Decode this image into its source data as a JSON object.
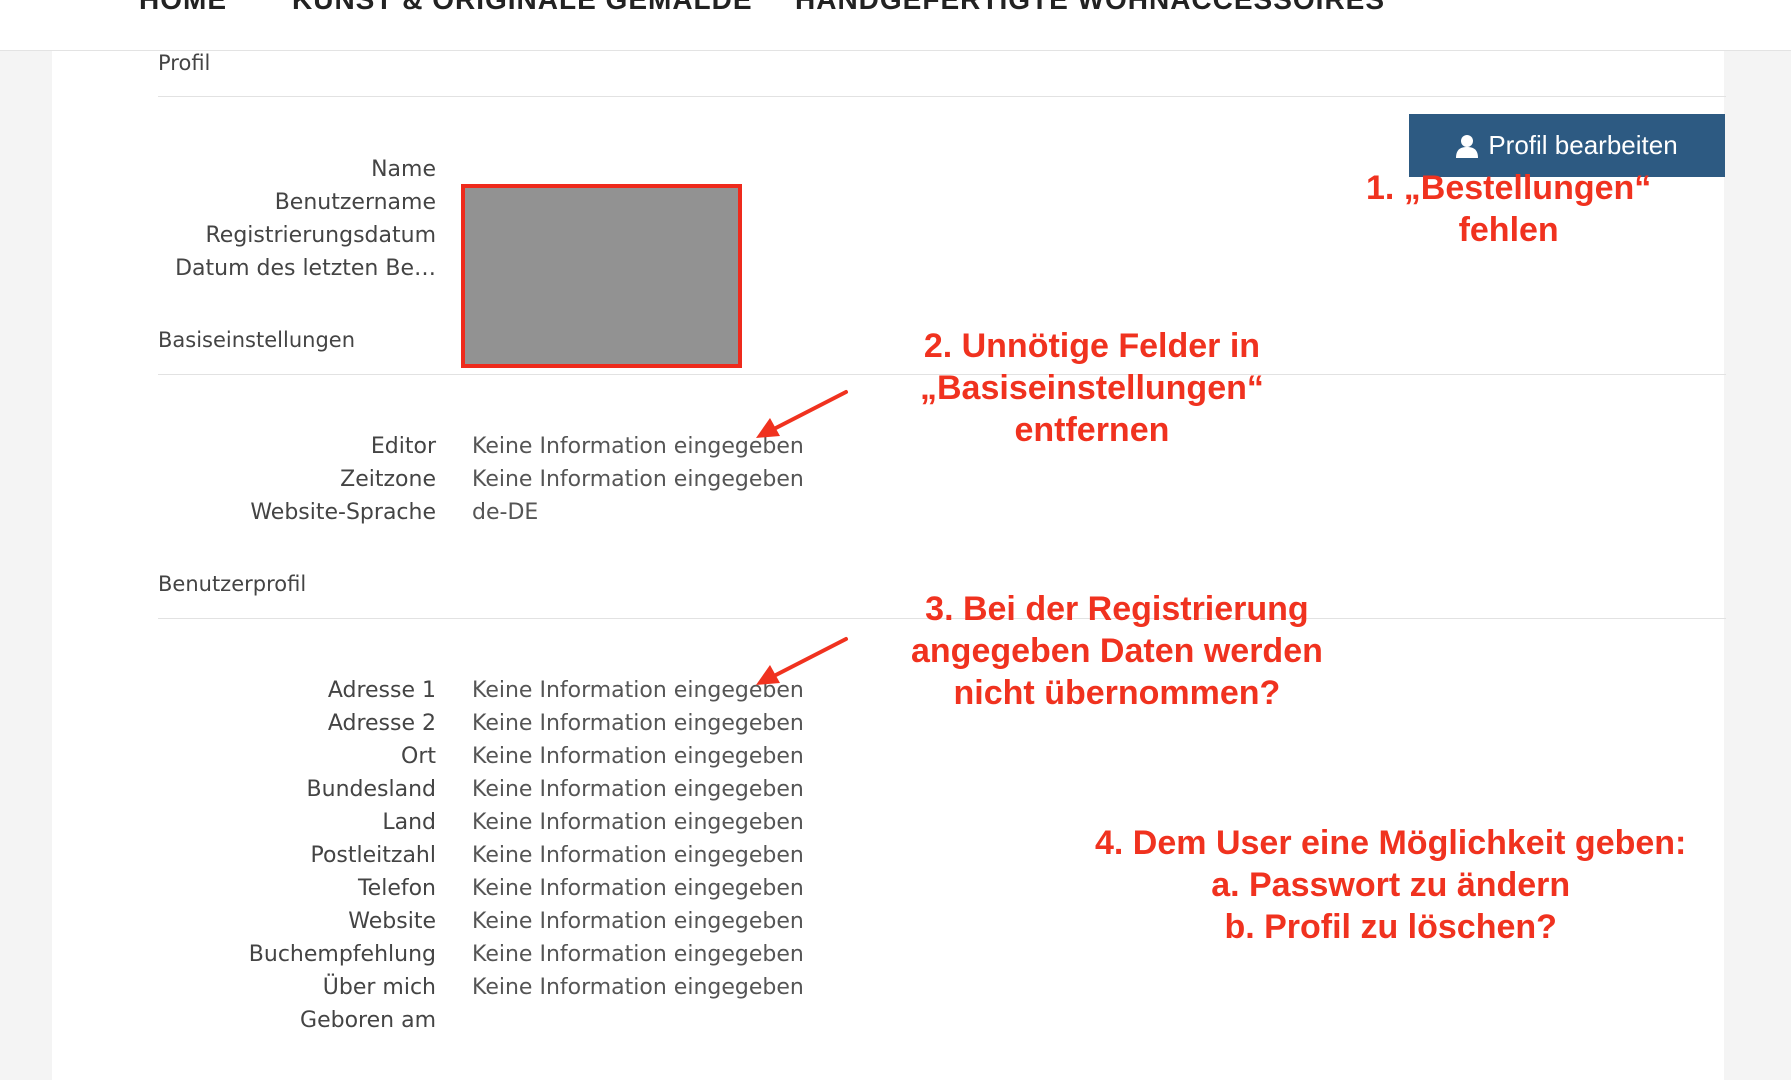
{
  "nav": {
    "items": [
      "HOME",
      "KUNST & ORIGINALE GEMÄLDE",
      "HANDGEFERTIGTE WOHNACCESSOIRES"
    ]
  },
  "profil": {
    "title": "Profil",
    "edit_button_label": "Profil bearbeiten",
    "fields": [
      "Name",
      "Benutzername",
      "Registrierungsdatum",
      "Datum des letzten Be…"
    ]
  },
  "basis": {
    "title": "Basiseinstellungen",
    "rows": [
      {
        "label": "Editor",
        "value": "Keine Information eingegeben"
      },
      {
        "label": "Zeitzone",
        "value": "Keine Information eingegeben"
      },
      {
        "label": "Website-Sprache",
        "value": "de-DE"
      }
    ]
  },
  "benutzerprofil": {
    "title": "Benutzerprofil",
    "rows": [
      {
        "label": "Adresse 1",
        "value": "Keine Information eingegeben"
      },
      {
        "label": "Adresse 2",
        "value": "Keine Information eingegeben"
      },
      {
        "label": "Ort",
        "value": "Keine Information eingegeben"
      },
      {
        "label": "Bundesland",
        "value": "Keine Information eingegeben"
      },
      {
        "label": "Land",
        "value": "Keine Information eingegeben"
      },
      {
        "label": "Postleitzahl",
        "value": "Keine Information eingegeben"
      },
      {
        "label": "Telefon",
        "value": "Keine Information eingegeben"
      },
      {
        "label": "Website",
        "value": "Keine Information eingegeben"
      },
      {
        "label": "Buchempfehlung",
        "value": "Keine Information eingegeben"
      },
      {
        "label": "Über mich",
        "value": "Keine Information eingegeben"
      },
      {
        "label": "Geboren am",
        "value": ""
      }
    ]
  },
  "annotations": {
    "note1": [
      "1. „Bestellungen“",
      "fehlen"
    ],
    "note2": [
      "2. Unnötige Felder in",
      "„Basiseinstellungen“",
      "entfernen"
    ],
    "note3": [
      "3. Bei der Registrierung",
      "angegeben Daten werden",
      "nicht übernommen?"
    ],
    "note4": [
      "4. Dem User eine Möglichkeit geben:",
      "a. Passwort zu ändern",
      "b. Profil zu löschen?"
    ],
    "color": "#f0321f"
  },
  "colors": {
    "button": "#2d5a82",
    "redaction_fill": "#929292",
    "redaction_border": "#ee2a1c"
  },
  "icons": {
    "edit_button": "user-icon"
  }
}
